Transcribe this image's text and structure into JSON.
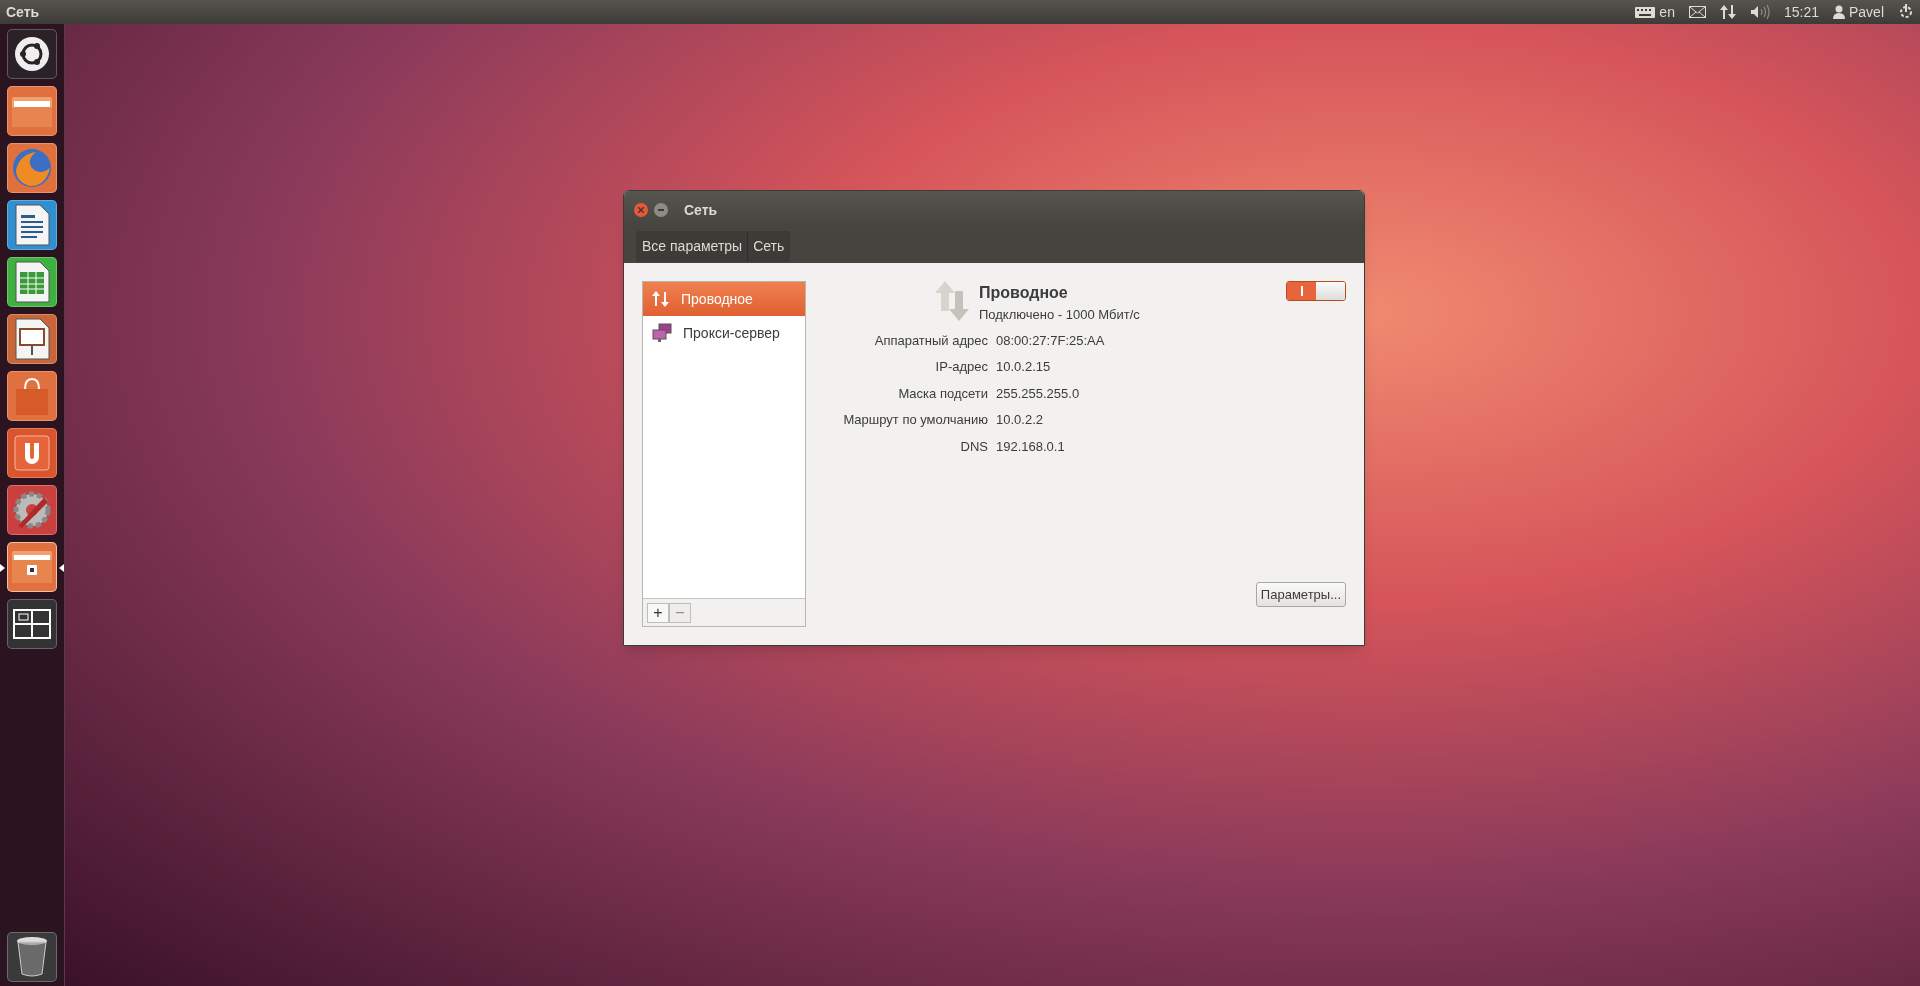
{
  "top_panel": {
    "app_title": "Сеть",
    "keyboard_layout": "en",
    "clock": "15:21",
    "user": "Pavel"
  },
  "launcher": {
    "items": [
      {
        "kind": "dash",
        "active": false
      },
      {
        "kind": "files",
        "active": false
      },
      {
        "kind": "browser",
        "active": false
      },
      {
        "kind": "writer",
        "active": false
      },
      {
        "kind": "calc",
        "active": false
      },
      {
        "kind": "impress",
        "active": false
      },
      {
        "kind": "store",
        "active": false
      },
      {
        "kind": "ubuntu_one",
        "active": false
      },
      {
        "kind": "settings",
        "active": false
      },
      {
        "kind": "network_folder",
        "active": true
      },
      {
        "kind": "workspaces",
        "active": false
      }
    ],
    "trash": {
      "kind": "trash"
    }
  },
  "window": {
    "title": "Сеть",
    "breadcrumbs": [
      "Все параметры",
      "Сеть"
    ]
  },
  "connections": [
    {
      "label": "Проводное",
      "kind": "wired",
      "selected": true
    },
    {
      "label": "Прокси-сервер",
      "kind": "proxy",
      "selected": false
    }
  ],
  "list_buttons": [
    "+",
    "−"
  ],
  "details": {
    "title": "Проводное",
    "status": "Подключено - 1000 Мбит/с",
    "on": true,
    "fields": [
      {
        "label": "Аппаратный адрес",
        "value": "08:00:27:7F:25:AA"
      },
      {
        "label": "IP-адрес",
        "value": "10.0.2.15"
      },
      {
        "label": "Маска подсети",
        "value": "255.255.255.0"
      },
      {
        "label": "Маршрут по умолчанию",
        "value": "10.0.2.2"
      },
      {
        "label": "DNS",
        "value": "192.168.0.1"
      }
    ],
    "options_button": "Параметры..."
  }
}
